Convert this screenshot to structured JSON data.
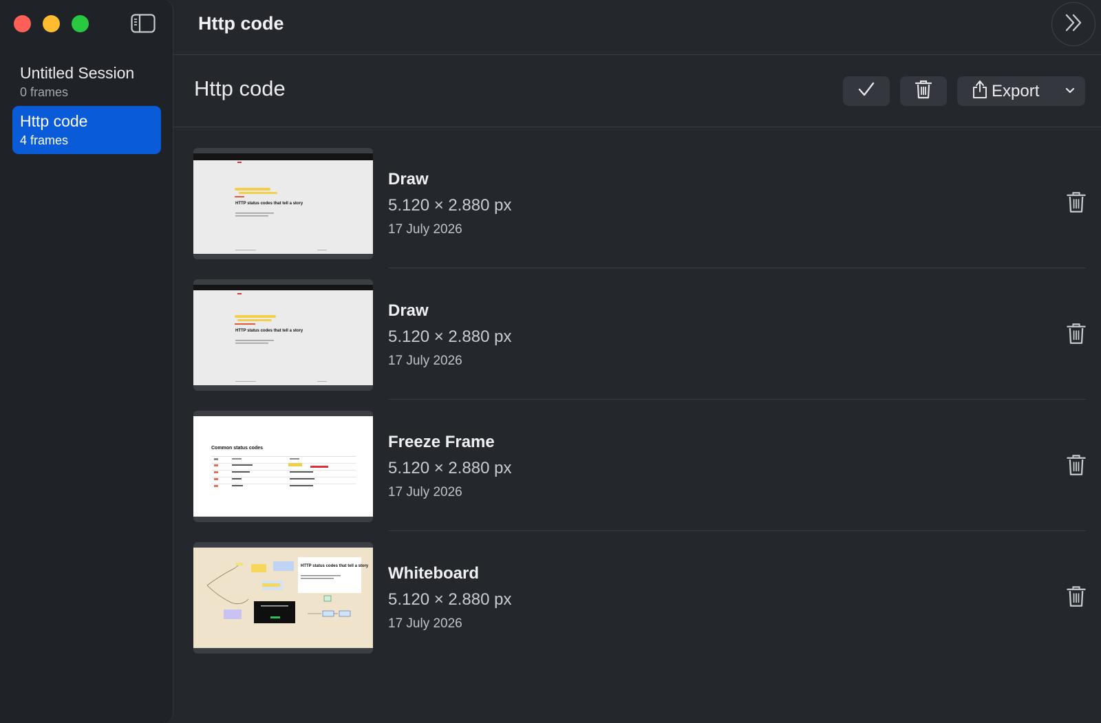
{
  "window": {
    "title": "Http code",
    "colors": {
      "selection": "#0a5bd8",
      "background": "#24282d",
      "sidebar": "#1f2328"
    }
  },
  "sidebar": {
    "sessions": [
      {
        "name": "Untitled Session",
        "frames": "0 frames",
        "selected": false
      },
      {
        "name": "Http code",
        "frames": "4 frames",
        "selected": true
      }
    ]
  },
  "header": {
    "heading": "Http code",
    "export_label": "Export"
  },
  "frames": [
    {
      "type": "Draw",
      "dimensions": "5.120 × 2.880 px",
      "date": "17 July 2026",
      "thumb_text": "HTTP status codes that tell a story"
    },
    {
      "type": "Draw",
      "dimensions": "5.120 × 2.880 px",
      "date": "17 July 2026",
      "thumb_text": "HTTP status codes that tell a story"
    },
    {
      "type": "Freeze Frame",
      "dimensions": "5.120 × 2.880 px",
      "date": "17 July 2026",
      "thumb_text": "Common status codes"
    },
    {
      "type": "Whiteboard",
      "dimensions": "5.120 × 2.880 px",
      "date": "17 July 2026",
      "thumb_text": "HTTP status codes that tell a story"
    }
  ],
  "icons": {
    "sidebar_toggle": "sidebar-toggle-icon",
    "forward": "double-chevron-right-icon",
    "check": "checkmark-icon",
    "trash": "trash-icon",
    "share": "share-icon",
    "chevron": "chevron-down-icon"
  }
}
